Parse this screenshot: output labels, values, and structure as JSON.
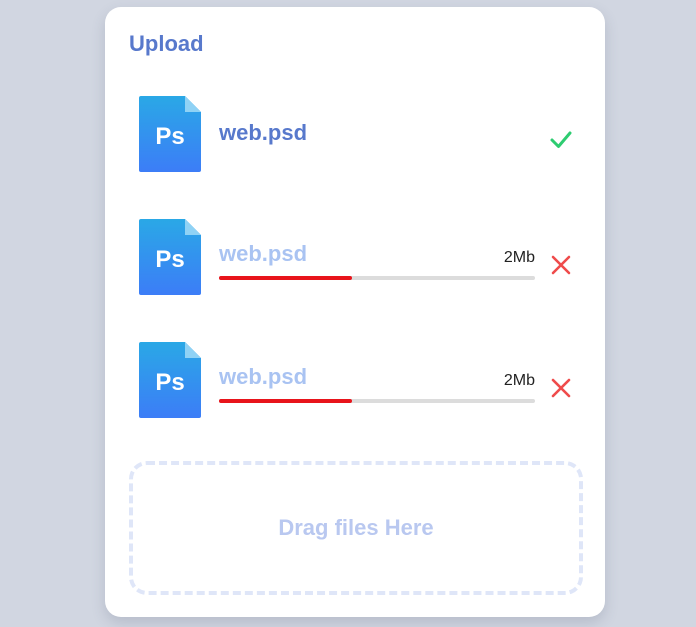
{
  "upload": {
    "title": "Upload",
    "files": [
      {
        "icon": "photoshop-file-icon",
        "icon_label": "Ps",
        "name": "web.psd",
        "status": "complete",
        "status_icon": "check-icon"
      },
      {
        "icon": "photoshop-file-icon",
        "icon_label": "Ps",
        "name": "web.psd",
        "size": "2Mb",
        "progress": 0.42,
        "status": "uploading",
        "status_icon": "close-icon"
      },
      {
        "icon": "photoshop-file-icon",
        "icon_label": "Ps",
        "name": "web.psd",
        "size": "2Mb",
        "progress": 0.42,
        "status": "uploading",
        "status_icon": "close-icon"
      }
    ],
    "dropzone_label": "Drag files Here"
  },
  "colors": {
    "title": "#5879cc",
    "pending_name": "#a9c3f2",
    "progress_fill": "#e8141b",
    "progress_track": "#dcdcdc",
    "success": "#2ecc71",
    "cancel": "#ef4b4b",
    "icon_gradient_top": "#2aa8e6",
    "icon_gradient_bottom": "#3c7df7"
  }
}
